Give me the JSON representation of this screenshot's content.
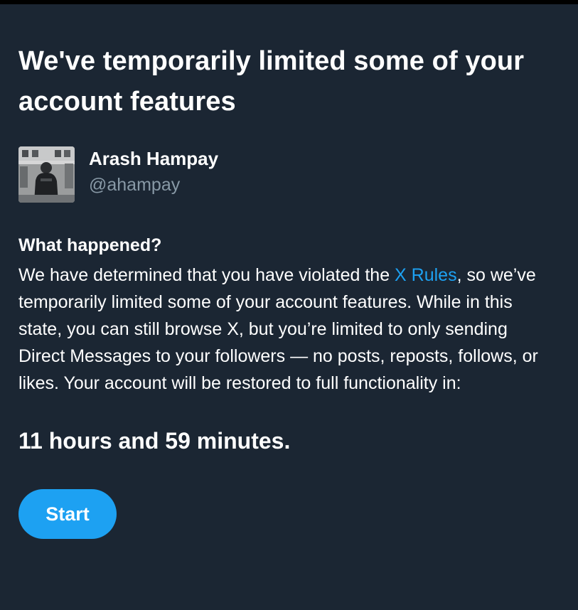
{
  "header": {
    "title": "We've temporarily limited some of your account features"
  },
  "user": {
    "name": "Arash Hampay",
    "handle": "@ahampay",
    "avatar_icon": "profile-photo"
  },
  "section": {
    "heading": "What happened?",
    "body_before_link": "We have determined that you have violated the ",
    "link_text": "X Rules",
    "body_after_link": ", so we’ve temporarily limited some of your account features. While in this state, you can still browse X, but you’re limited to only sending Direct Messages to your followers — no posts, reposts, follows, or likes. Your account will be restored to full functionality in:"
  },
  "countdown": {
    "text": "11 hours and 59 minutes."
  },
  "actions": {
    "start_label": "Start"
  },
  "colors": {
    "background": "#1b2633",
    "text": "#ffffff",
    "secondary_text": "#8899a6",
    "accent": "#1da1f2"
  }
}
